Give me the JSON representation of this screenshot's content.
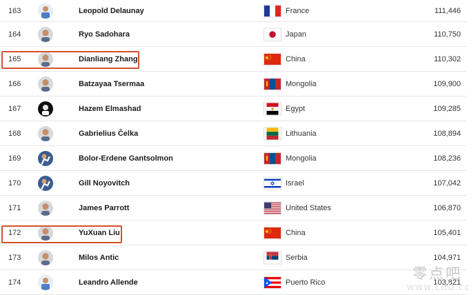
{
  "rankings": [
    {
      "rank": "163",
      "name": "Leopold Delaunay",
      "country": "France",
      "points": "111,446",
      "flag": "france",
      "avatar": "player-jersey",
      "highlighted": false
    },
    {
      "rank": "164",
      "name": "Ryo Sadohara",
      "country": "Japan",
      "points": "110,750",
      "flag": "japan",
      "avatar": "player-face",
      "highlighted": false
    },
    {
      "rank": "165",
      "name": "Dianliang Zhang",
      "country": "China",
      "points": "110,302",
      "flag": "china",
      "avatar": "player-face",
      "highlighted": true
    },
    {
      "rank": "166",
      "name": "Batzayaa Tsermaa",
      "country": "Mongolia",
      "points": "109,900",
      "flag": "mongolia",
      "avatar": "player-face",
      "highlighted": false
    },
    {
      "rank": "167",
      "name": "Hazem Elmashad",
      "country": "Egypt",
      "points": "109,285",
      "flag": "egypt",
      "avatar": "player-dark",
      "highlighted": false
    },
    {
      "rank": "168",
      "name": "Gabrielius Čelka",
      "country": "Lithuania",
      "points": "108,894",
      "flag": "lithuania",
      "avatar": "player-face",
      "highlighted": false
    },
    {
      "rank": "169",
      "name": "Bolor-Erdene Gantsolmon",
      "country": "Mongolia",
      "points": "108,236",
      "flag": "mongolia",
      "avatar": "player-action",
      "highlighted": false
    },
    {
      "rank": "170",
      "name": "Gill Noyovitch",
      "country": "Israel",
      "points": "107,042",
      "flag": "israel",
      "avatar": "player-action",
      "highlighted": false
    },
    {
      "rank": "171",
      "name": "James Parrott",
      "country": "United States",
      "points": "106,870",
      "flag": "usa",
      "avatar": "player-face",
      "highlighted": false
    },
    {
      "rank": "172",
      "name": "YuXuan Liu",
      "country": "China",
      "points": "105,401",
      "flag": "china",
      "avatar": "player-face",
      "highlighted": true
    },
    {
      "rank": "173",
      "name": "Milos Antic",
      "country": "Serbia",
      "points": "104,971",
      "flag": "serbia",
      "avatar": "player-face",
      "highlighted": false
    },
    {
      "rank": "174",
      "name": "Leandro Allende",
      "country": "Puerto Rico",
      "points": "103,821",
      "flag": "puerto-rico",
      "avatar": "player-jersey",
      "highlighted": false
    }
  ],
  "colors": {
    "highlight_border": "#d4502a",
    "row_divider": "#e6e6e6"
  },
  "watermark": {
    "main": "零点吧",
    "sub": "www.Ldb.cc"
  }
}
